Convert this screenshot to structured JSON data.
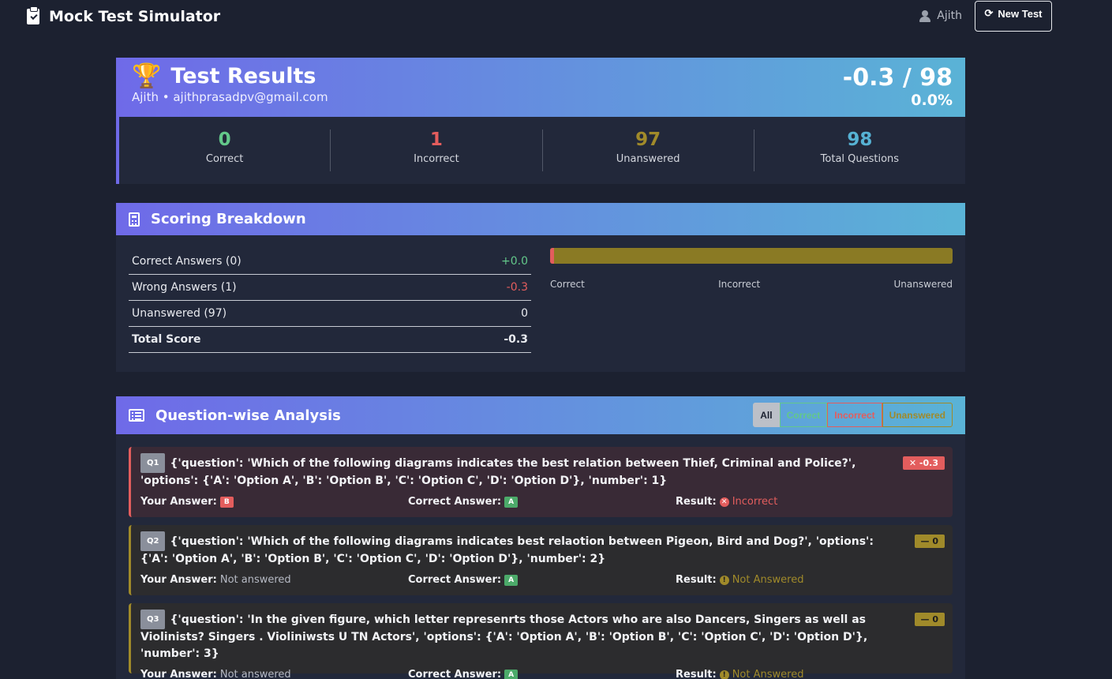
{
  "app": {
    "title": "Mock Test Simulator",
    "user": "Ajith",
    "new_test_label": "New Test"
  },
  "results": {
    "title": "Test Results",
    "subtitle": "Ajith • ajithprasadpv@gmail.com",
    "score": "-0.3 / 98",
    "percent": "0.0%",
    "stats": [
      {
        "value": "0",
        "label": "Correct",
        "color": "#63c88a"
      },
      {
        "value": "1",
        "label": "Incorrect",
        "color": "#e35d5d"
      },
      {
        "value": "97",
        "label": "Unanswered",
        "color": "#a08a2a"
      },
      {
        "value": "98",
        "label": "Total Questions",
        "color": "#56b2d4"
      }
    ]
  },
  "breakdown": {
    "title": "Scoring Breakdown",
    "rows": [
      {
        "label": "Correct Answers (0)",
        "value": "+0.0",
        "color": "#63c88a"
      },
      {
        "label": "Wrong Answers (1)",
        "value": "-0.3",
        "color": "#e35d5d"
      },
      {
        "label": "Unanswered (97)",
        "value": "0",
        "color": "#e8eaef"
      }
    ],
    "total_label": "Total Score",
    "total_value": "-0.3",
    "bar": {
      "correct_fraction": 0.0,
      "incorrect_fraction": 0.0102,
      "unanswered_fraction": 0.9898
    },
    "bar_labels": [
      "Correct",
      "Incorrect",
      "Unanswered"
    ]
  },
  "analysis": {
    "title": "Question-wise Analysis",
    "filters": [
      "All",
      "Correct",
      "Incorrect",
      "Unanswered"
    ],
    "your_answer_label": "Your Answer:",
    "correct_answer_label": "Correct Answer:",
    "result_label": "Result:",
    "questions": [
      {
        "num": "Q1",
        "text": "{'question': 'Which of the following diagrams indicates the best relation between Thief, Criminal and Police?', 'options': {'A': 'Option A', 'B': 'Option B', 'C': 'Option C', 'D': 'Option D'}, 'number': 1}",
        "badge": "✕ -0.3",
        "your_answer": "B",
        "correct_answer": "A",
        "result": "Incorrect"
      },
      {
        "num": "Q2",
        "text": "{'question': 'Which of the following diagrams indicates best relaotion between Pigeon, Bird and Dog?', 'options': {'A': 'Option A', 'B': 'Option B', 'C': 'Option C', 'D': 'Option D'}, 'number': 2}",
        "badge": "— 0",
        "your_answer": "Not answered",
        "correct_answer": "A",
        "result": "Not Answered"
      },
      {
        "num": "Q3",
        "text": "{'question': 'In the given figure, which letter represenrts those Actors who are also Dancers, Singers as well as Violinists? Singers . Violiniwsts U TN Actors', 'options': {'A': 'Option A', 'B': 'Option B', 'C': 'Option C', 'D': 'Option D'}, 'number': 3}",
        "badge": "— 0",
        "your_answer": "Not answered",
        "correct_answer": "A",
        "result": "Not Answered"
      }
    ]
  }
}
